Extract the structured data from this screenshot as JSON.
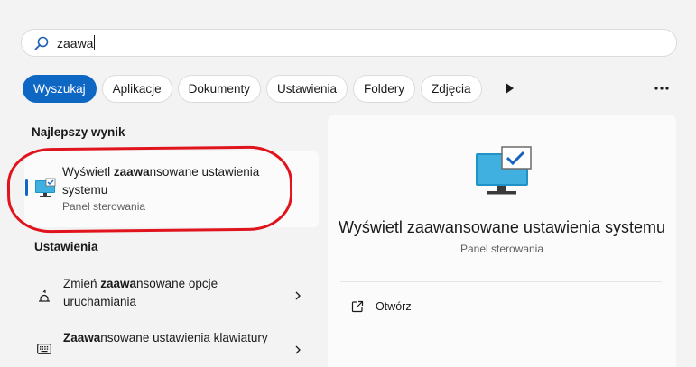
{
  "search": {
    "value": "zaawa",
    "icon": "search-icon"
  },
  "filters": {
    "tabs": [
      {
        "label": "Wyszukaj",
        "active": true
      },
      {
        "label": "Aplikacje",
        "active": false
      },
      {
        "label": "Dokumenty",
        "active": false
      },
      {
        "label": "Ustawienia",
        "active": false
      },
      {
        "label": "Foldery",
        "active": false
      },
      {
        "label": "Zdjęcia",
        "active": false
      }
    ],
    "accent_color": "#0f67c4"
  },
  "best_match": {
    "heading": "Najlepszy wynik",
    "title_bold": "zaawa",
    "title_before": "Wyświetl ",
    "title_after": "nsowane ustawienia systemu",
    "subtitle": "Panel sterowania",
    "icon": "monitor-check-icon",
    "highlight_color": "#e1141e"
  },
  "settings": {
    "heading": "Ustawienia",
    "items": [
      {
        "before": "Zmień ",
        "bold": "zaawa",
        "after": "nsowane opcje uruchamiania",
        "icon": "startup-options-icon"
      },
      {
        "before": "",
        "bold": "Zaawa",
        "after": "nsowane ustawienia klawiatury",
        "icon": "keyboard-icon"
      }
    ]
  },
  "preview": {
    "title": "Wyświetl zaawansowane ustawienia systemu",
    "subtitle": "Panel sterowania",
    "action_label": "Otwórz",
    "action_icon": "open-external-icon"
  }
}
